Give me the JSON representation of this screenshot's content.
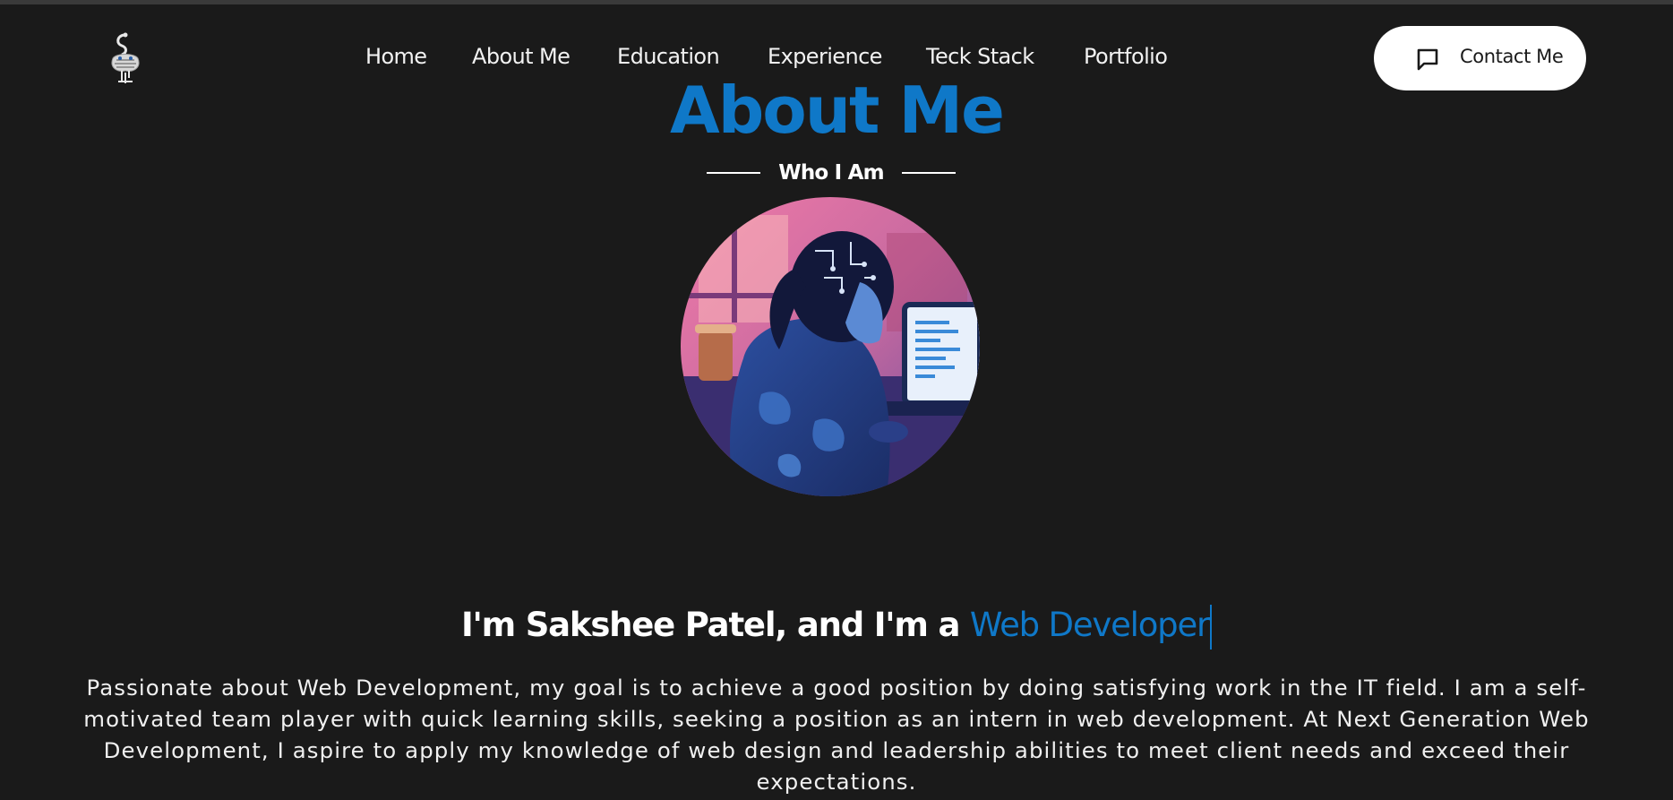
{
  "nav": {
    "items": [
      {
        "label": "Home"
      },
      {
        "label": "About Me"
      },
      {
        "label": "Education"
      },
      {
        "label": "Experience"
      },
      {
        "label": "Teck Stack"
      },
      {
        "label": "Portfolio"
      }
    ]
  },
  "contact_button": {
    "label": "Contact Me",
    "icon": "chat-icon"
  },
  "section": {
    "title": "About Me",
    "subtitle": "Who I Am"
  },
  "intro": {
    "prefix": "I'm Sakshee Patel, and I'm a ",
    "role": "Web Developer"
  },
  "description": "Passionate about Web Development, my goal is to achieve a good position by doing satisfying work in the IT field. I am a self-motivated team player with quick learning skills, seeking a position as an intern in web development. At Next Generation Web Development, I aspire to apply my knowledge of web design and leadership abilities to meet client needs and exceed their expectations.",
  "colors": {
    "background": "#1a1a1a",
    "accent": "#0f78c8",
    "button_bg": "#ffffff"
  }
}
